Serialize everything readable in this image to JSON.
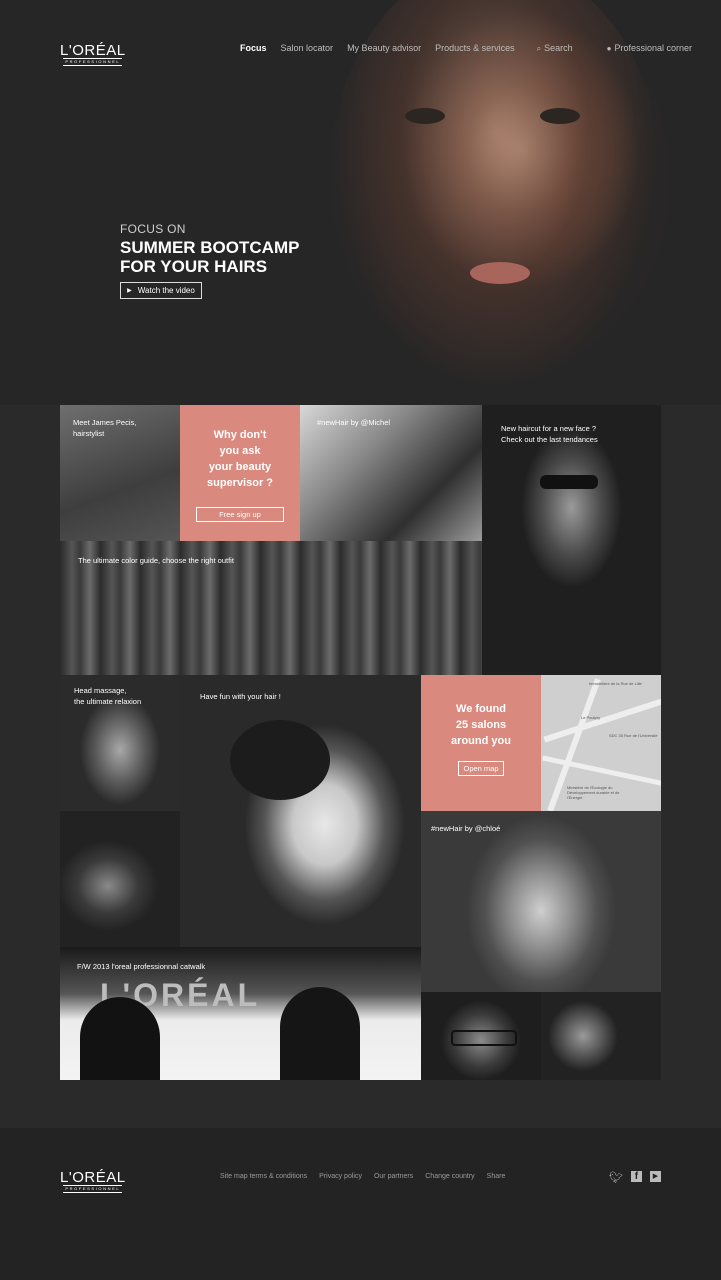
{
  "header": {
    "logo": {
      "brand": "L'ORÉAL",
      "sub": "PROFESSIONNEL"
    },
    "nav": [
      {
        "label": "Focus",
        "active": true
      },
      {
        "label": "Salon locator"
      },
      {
        "label": "My Beauty advisor"
      },
      {
        "label": "Products & services"
      }
    ],
    "search": {
      "label": "Search",
      "icon": "search-icon"
    },
    "pro": {
      "label": "Professional corner",
      "icon": "user-icon"
    }
  },
  "hero": {
    "kicker": "FOCUS ON",
    "title_line1": "SUMMER BOOTCAMP",
    "title_line2": "FOR YOUR HAIRS",
    "cta": "Watch the video"
  },
  "tiles": {
    "james": "Meet James Pecis, hairstylist",
    "beauty": {
      "line1": "Why don't",
      "line2": "you ask",
      "line3": "your beauty",
      "line4": "supervisor ?",
      "button": "Free sign up"
    },
    "michel": "#newHair by @Michel",
    "haircut": {
      "line1": "New haircut for a new face ?",
      "line2": "Check out the last tendances"
    },
    "color": "The ultimate color guide, choose the right outfit",
    "massage": {
      "line1": "Head massage,",
      "line2": "the ultimate relaxion"
    },
    "fun": "Have fun with your hair !",
    "salons": {
      "line1": "We found",
      "line2": "25 salons",
      "line3": "around you",
      "button": "Open map"
    },
    "map_labels": [
      "Immobilière de la Rue de Lille",
      "Le Poulpry",
      "SDC 35 Rue de l'Université",
      "Ministère de l'Écologie du Développement durable et de l'Énergie"
    ],
    "chloe": "#newHair by @chloé",
    "catwalk": "F/W 2013 l'oreal professionnal catwalk",
    "stage_sign": "L'ORÉAL"
  },
  "footer": {
    "logo": {
      "brand": "L'ORÉAL",
      "sub": "PROFESSIONNEL"
    },
    "links": [
      "Site map terms & conditions",
      "Privacy policy",
      "Our partners",
      "Change country",
      "Share"
    ],
    "social": [
      "twitter-icon",
      "facebook-icon",
      "youtube-icon"
    ]
  },
  "colors": {
    "accent": "#d9897e",
    "background": "#2a2a2a",
    "footer": "#232323"
  }
}
